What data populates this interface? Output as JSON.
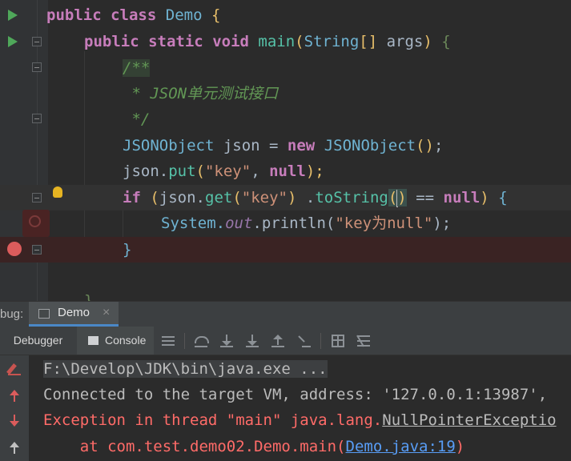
{
  "editor": {
    "code": {
      "l1": {
        "kw1": "public",
        "kw2": "class",
        "name": "Demo",
        "brace": "{"
      },
      "l2": {
        "kw1": "public",
        "kw2": "static",
        "kw3": "void",
        "method": "main",
        "p1": "(",
        "type": "String",
        "arr": "[]",
        "param": " args",
        "p2": ")",
        "brace": "{"
      },
      "l3": {
        "open": "/**"
      },
      "l4": {
        "text": " * JSON单元测试接口"
      },
      "l5": {
        "text": " */"
      },
      "l6": {
        "type": "JSONObject",
        "var": " json = ",
        "kw": "new",
        "type2": "JSONObject",
        "paren": "()",
        "semi": ";"
      },
      "l7": {
        "obj": "json.",
        "method": "put",
        "p1": "(",
        "str1": "\"key\"",
        "comma": ", ",
        "kw": "null",
        "p2": ");"
      },
      "l8": {
        "kw": "if",
        "sp": " ",
        "p1": "(",
        "obj": "json.",
        "method": "get",
        "p2": "(",
        "str": "\"key\"",
        "p3": ")",
        "dot": " .",
        "method2": "toString",
        "paren_open": "(",
        "paren_close": ")",
        "op": " == ",
        "kw2": "null",
        "p4": ")",
        "brace": "{"
      },
      "l9": {
        "cls": "System.",
        "field": "out",
        "call": ".println(",
        "str": "\"key为null\"",
        "end": ");"
      },
      "l10": {
        "brace": "}"
      },
      "l11": {
        "brace": "}"
      }
    }
  },
  "debug": {
    "panel_label": "bug:",
    "session_tab": "Demo",
    "close": "×",
    "tabs": {
      "debugger": "Debugger",
      "console": "Console"
    }
  },
  "console": {
    "cmd": "F:\\Develop\\JDK\\bin\\java.exe ...",
    "connected": "Connected to the target VM, address: '127.0.0.1:13987',",
    "exception_prefix": "Exception in thread \"main\" java.lang.",
    "exception_class": "NullPointerExceptio",
    "at_prefix": "    at com.test.demo02.Demo.main(",
    "at_link": "Demo.java:19",
    "at_suffix": ")"
  },
  "colors": {
    "background": "#2b2b2b",
    "keyword": "#cc7832",
    "string": "#6a8759",
    "error": "#ff6b68",
    "link": "#589df6",
    "breakpoint": "#db5c5c",
    "run": "#4fa85a"
  },
  "icons": [
    "run-icon",
    "fold-icon",
    "breakpoint-icon",
    "bulb-icon",
    "search-icon",
    "console-icon",
    "step-over-icon",
    "step-into-icon",
    "force-step-into-icon",
    "step-out-icon",
    "run-to-cursor-icon",
    "evaluate-icon",
    "trace-icon",
    "pencil-icon",
    "arrow-up-icon",
    "arrow-down-icon"
  ]
}
